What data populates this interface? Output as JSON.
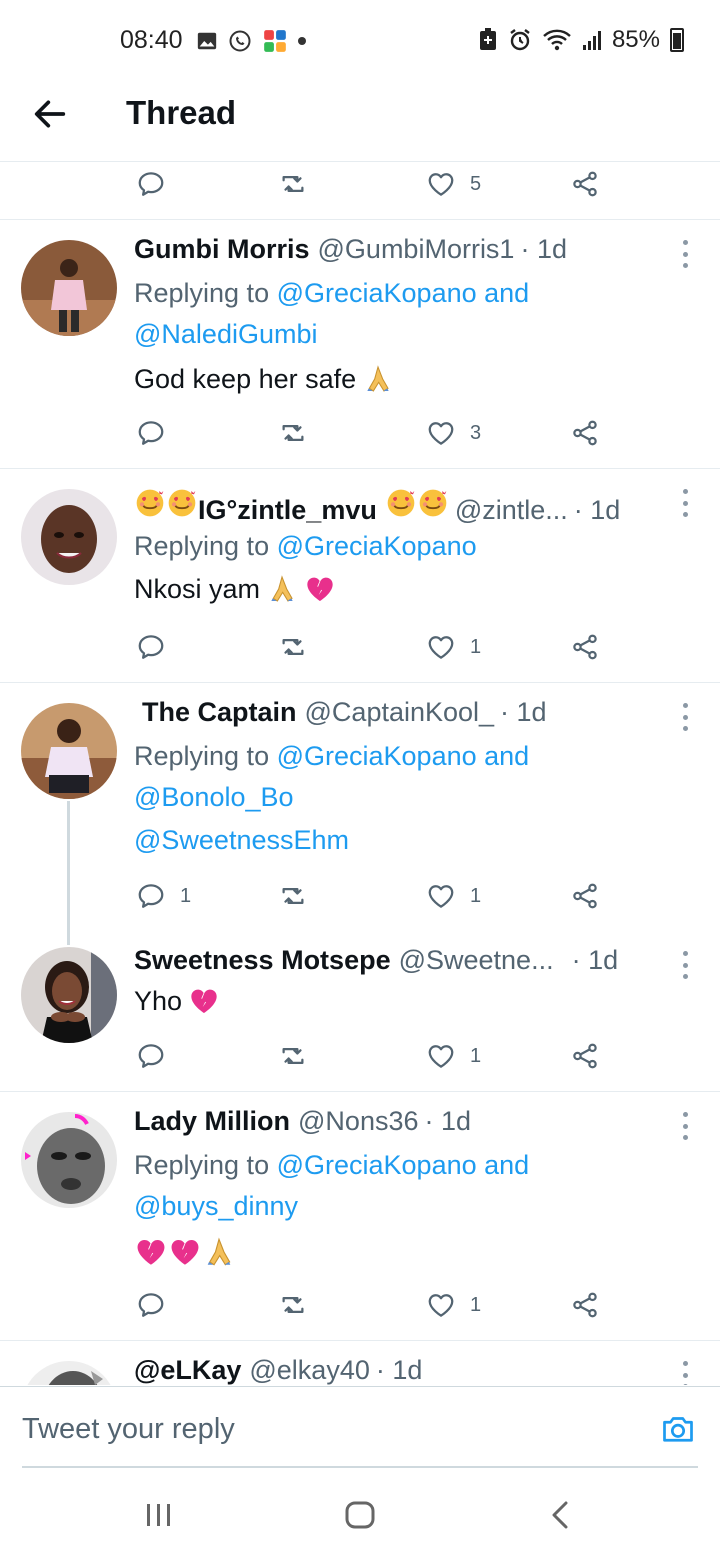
{
  "status_bar": {
    "time": "08:40",
    "battery": "85%"
  },
  "header": {
    "title": "Thread"
  },
  "top_actions": {
    "like_count": "5"
  },
  "tweets": [
    {
      "name": "Gumbi Morris",
      "handle": "@GumbiMorris1",
      "time": "· 1d",
      "replying_prefix": "Replying to ",
      "mentions_line1": "@GreciaKopano and",
      "mentions_line2": "@NalediGumbi",
      "text": "God keep her safe",
      "reply_count": "",
      "retweet_count": "",
      "like_count": "3"
    },
    {
      "name": "IG°zintle_mvu",
      "handle": "@zintle...",
      "time": "· 1d",
      "replying_prefix": "Replying to ",
      "mentions_line1": "@GreciaKopano",
      "text": "Nkosi yam",
      "like_count": "1"
    },
    {
      "name": "The Captain",
      "handle": "@CaptainKool_",
      "time": "· 1d",
      "replying_prefix": "Replying to ",
      "mentions_line1": "@GreciaKopano and",
      "mentions_line2": "@Bonolo_Bo",
      "mentions_line3": "@SweetnessEhm",
      "reply_count": "1",
      "like_count": "1"
    },
    {
      "name": "Sweetness Motsepe",
      "handle": "@Sweetne...",
      "time": "· 1d",
      "text": "Yho",
      "like_count": "1"
    },
    {
      "name": "Lady Million",
      "handle": "@Nons36",
      "time": "· 1d",
      "replying_prefix": "Replying to ",
      "mentions_line1": "@GreciaKopano and",
      "mentions_line2": "@buys_dinny",
      "like_count": "1"
    },
    {
      "name": "@eLKay",
      "handle": "@elkay40",
      "time": "· 1d"
    }
  ],
  "reply_bar": {
    "placeholder": "Tweet your reply"
  },
  "icons": {
    "reply": "reply-icon",
    "retweet": "retweet-icon",
    "like": "heart-icon",
    "share": "share-icon",
    "camera": "camera-icon",
    "back": "back-arrow-icon"
  },
  "colors": {
    "link": "#1d9bf0",
    "secondary_text": "#536471",
    "divider": "#e6ecf0"
  }
}
